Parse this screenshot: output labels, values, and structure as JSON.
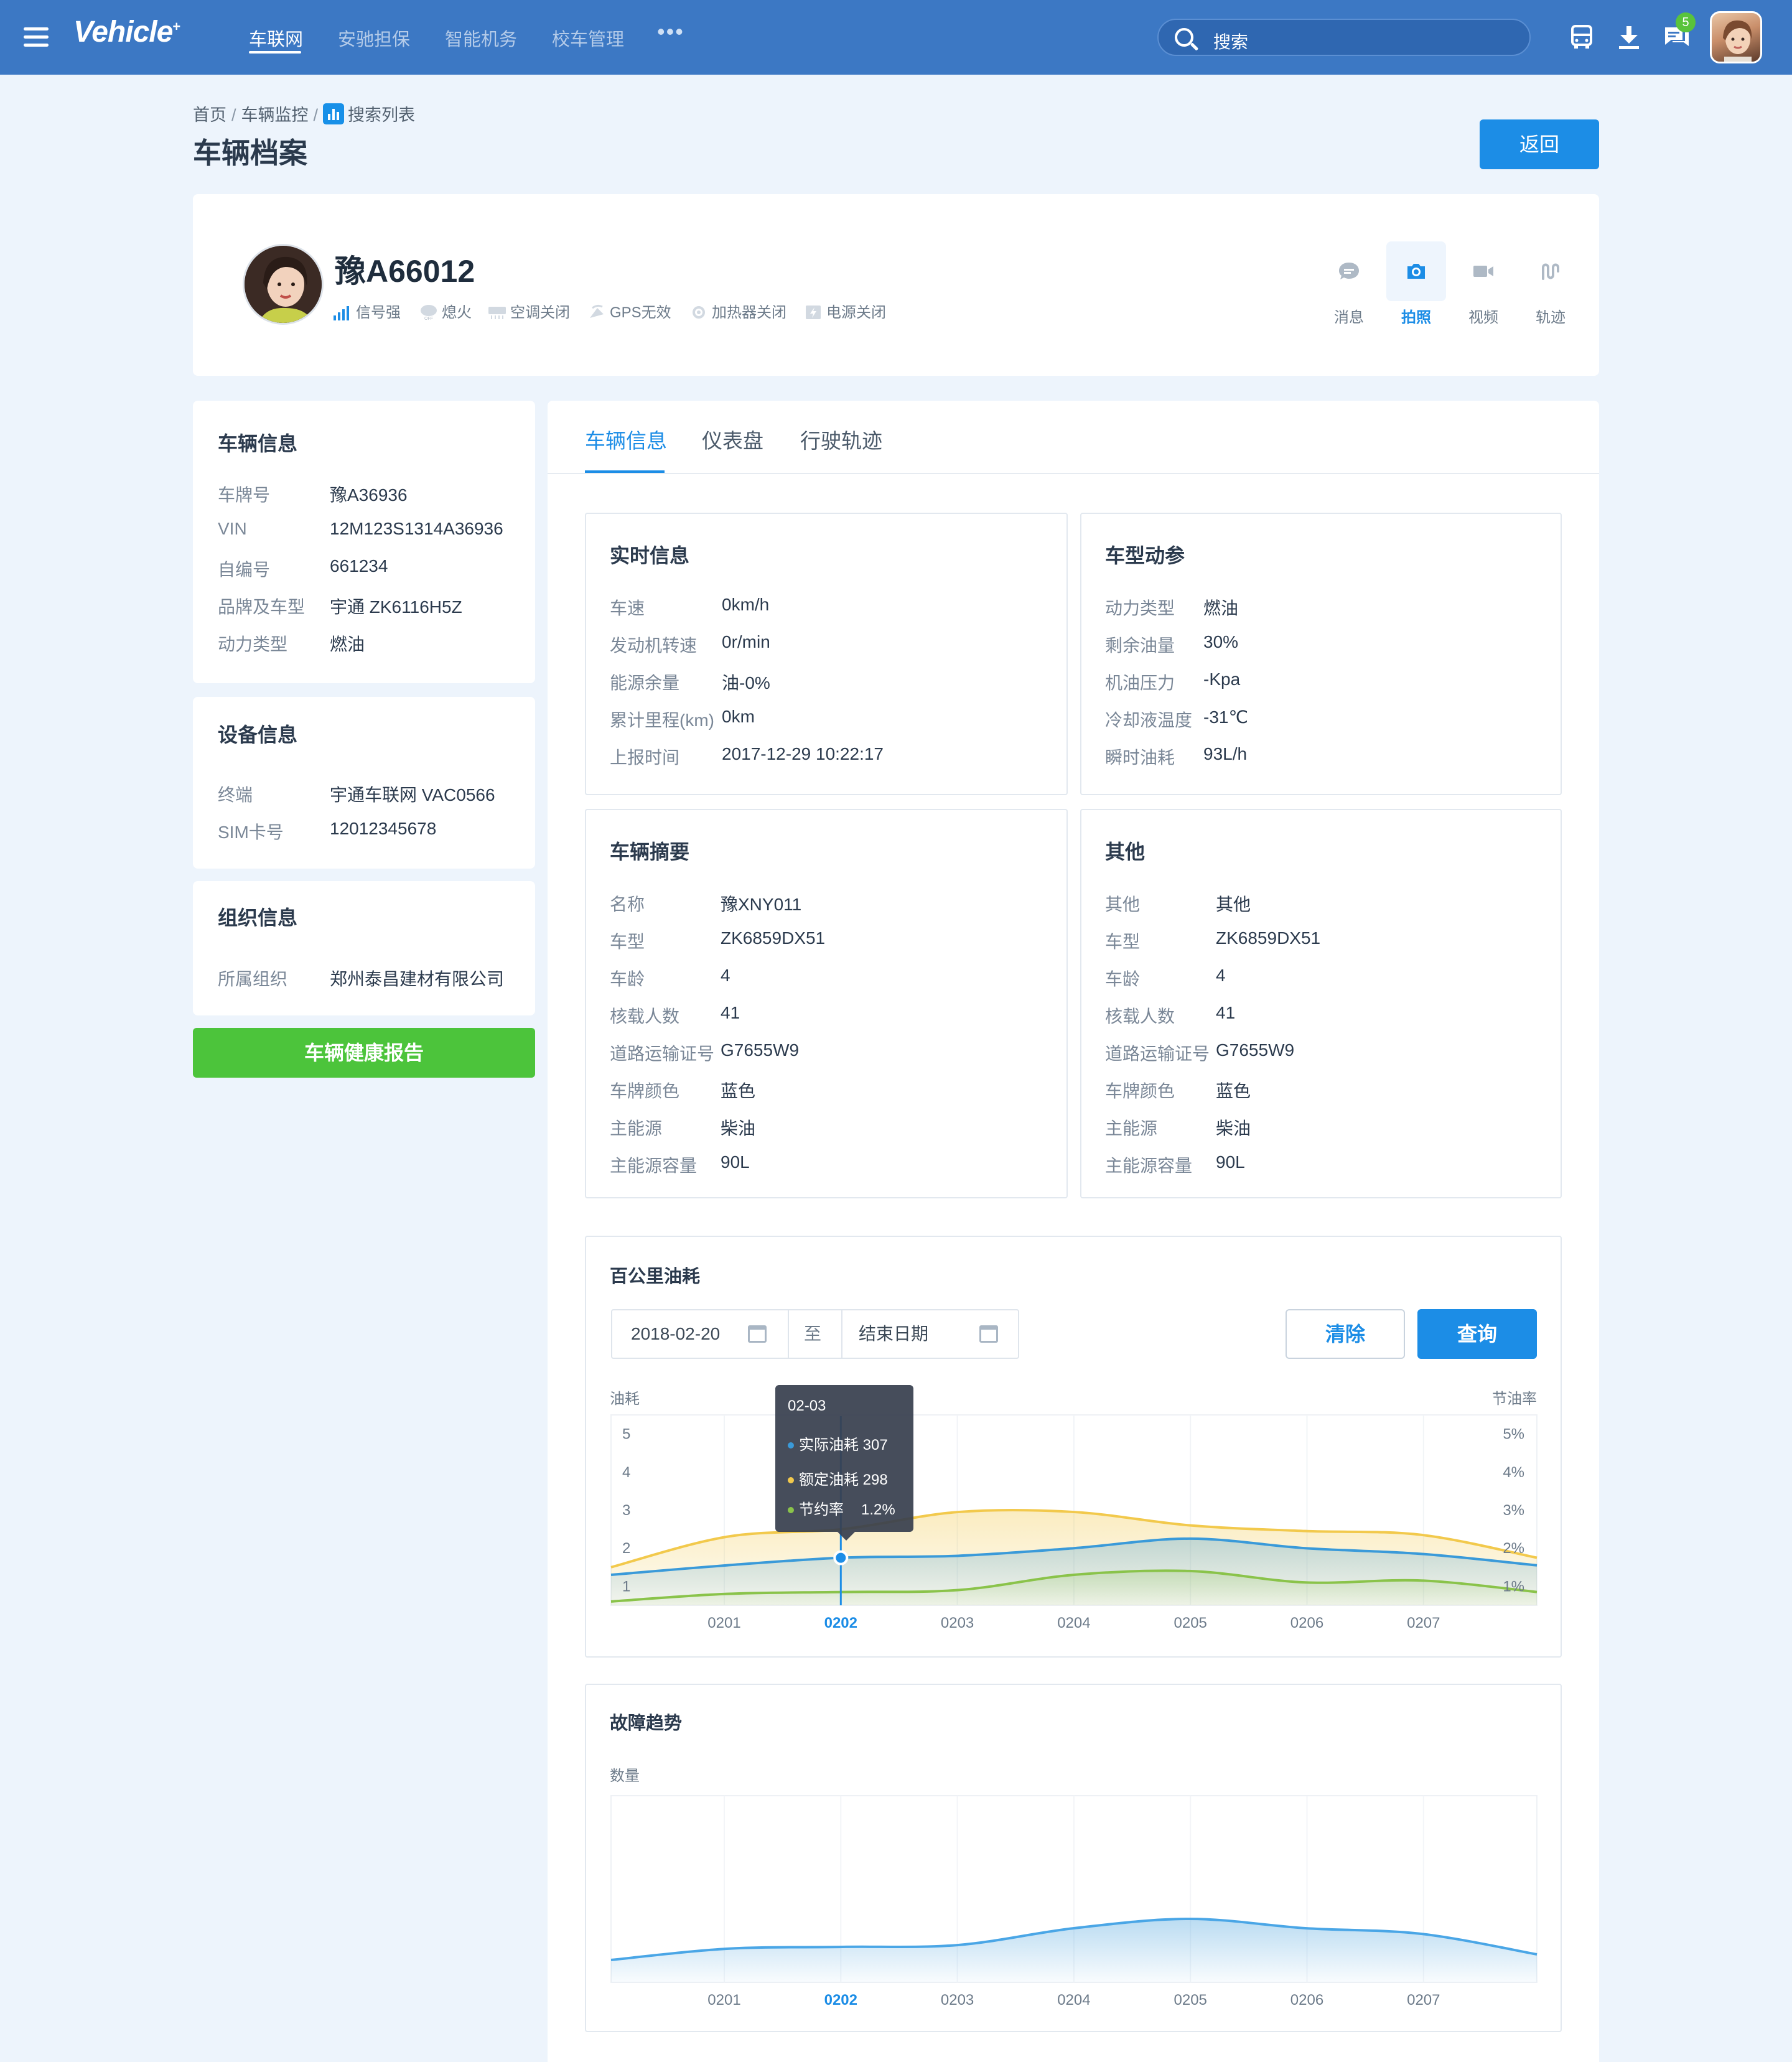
{
  "topbar": {
    "logo": "Vehicle",
    "logo_mark": "+",
    "nav": [
      "车联网",
      "安驰担保",
      "智能机务",
      "校车管理"
    ],
    "more": "•••",
    "search_label": "搜索",
    "message_count": "5"
  },
  "breadcrumb": [
    "首页",
    "车辆监控",
    "搜索列表"
  ],
  "page_title": "车辆档案",
  "back_label": "返回",
  "vehicle": {
    "plate": "豫A66012",
    "statuses": [
      "信号强",
      "熄火",
      "空调关闭",
      "GPS无效",
      "加热器关闭",
      "电源关闭"
    ],
    "actions": [
      "消息",
      "拍照",
      "视频",
      "轨迹"
    ]
  },
  "vehicle_info": {
    "title": "车辆信息",
    "rows": [
      {
        "k": "车牌号",
        "v": "豫A36936"
      },
      {
        "k": "VIN",
        "v": "12M123S1314A36936"
      },
      {
        "k": "自编号",
        "v": "661234"
      },
      {
        "k": "品牌及车型",
        "v": "宇通 ZK6116H5Z"
      },
      {
        "k": "动力类型",
        "v": "燃油"
      }
    ]
  },
  "device_info": {
    "title": "设备信息",
    "rows": [
      {
        "k": "终端",
        "v": "宇通车联网 VAC0566"
      },
      {
        "k": "SIM卡号",
        "v": "12012345678"
      }
    ]
  },
  "org_info": {
    "title": "组织信息",
    "rows": [
      {
        "k": "所属组织",
        "v": "郑州泰昌建材有限公司"
      }
    ]
  },
  "health_report_label": "车辆健康报告",
  "tabs": [
    "车辆信息",
    "仪表盘",
    "行驶轨迹"
  ],
  "realtime": {
    "title": "实时信息",
    "rows": [
      {
        "k": "车速",
        "v": "0km/h"
      },
      {
        "k": "发动机转速",
        "v": "0r/min"
      },
      {
        "k": "能源余量",
        "v": "油-0%"
      },
      {
        "k": "累计里程(km)",
        "v": "0km"
      },
      {
        "k": "上报时间",
        "v": "2017-12-29 10:22:17"
      }
    ]
  },
  "model_params": {
    "title": "车型动参",
    "rows": [
      {
        "k": "动力类型",
        "v": "燃油"
      },
      {
        "k": "剩余油量",
        "v": "30%"
      },
      {
        "k": "机油压力",
        "v": "-Kpa"
      },
      {
        "k": "冷却液温度",
        "v": "-31℃"
      },
      {
        "k": "瞬时油耗",
        "v": "93L/h"
      }
    ]
  },
  "summary": {
    "title": "车辆摘要",
    "rows": [
      {
        "k": "名称",
        "v": "豫XNY011"
      },
      {
        "k": "车型",
        "v": "ZK6859DX51"
      },
      {
        "k": "车龄",
        "v": "4"
      },
      {
        "k": "核载人数",
        "v": "41"
      },
      {
        "k": "道路运输证号",
        "v": "G7655W9"
      },
      {
        "k": "车牌颜色",
        "v": "蓝色"
      },
      {
        "k": "主能源",
        "v": "柴油"
      },
      {
        "k": "主能源容量",
        "v": "90L"
      }
    ]
  },
  "other": {
    "title": "其他",
    "rows": [
      {
        "k": "其他",
        "v": "其他"
      },
      {
        "k": "车型",
        "v": "ZK6859DX51"
      },
      {
        "k": "车龄",
        "v": "4"
      },
      {
        "k": "核载人数",
        "v": "41"
      },
      {
        "k": "道路运输证号",
        "v": "G7655W9"
      },
      {
        "k": "车牌颜色",
        "v": "蓝色"
      },
      {
        "k": "主能源",
        "v": "柴油"
      },
      {
        "k": "主能源容量",
        "v": "90L"
      }
    ]
  },
  "fuel_chart": {
    "title": "百公里油耗",
    "start_date": "2018-02-20",
    "to_label": "至",
    "end_placeholder": "结束日期",
    "clear_label": "清除",
    "query_label": "查询",
    "left_axis_label": "油耗",
    "right_axis_label": "节油率",
    "tooltip": {
      "date": "02-03",
      "rows": [
        {
          "name": "实际油耗",
          "value": "307"
        },
        {
          "name": "额定油耗",
          "value": "298"
        },
        {
          "name": "节约率",
          "value": "1.2%"
        }
      ]
    }
  },
  "fault_chart": {
    "title": "故障趋势",
    "axis_label": "数量"
  },
  "colors": {
    "brand": "#3c78c4",
    "accent": "#1c8de6",
    "success": "#4cc43b",
    "series_actual": "#3a9ad9",
    "series_rated": "#f2c94c",
    "series_saving": "#8ac34a"
  },
  "chart_data": [
    {
      "type": "area",
      "x": [
        "0201",
        "0202",
        "0203",
        "0204",
        "0205",
        "0206",
        "0207"
      ],
      "highlight_x": "0202",
      "left_ticks": [
        "1",
        "2",
        "3",
        "4",
        "5"
      ],
      "right_ticks": [
        "1%",
        "2%",
        "3%",
        "4%",
        "5%"
      ],
      "ylim": [
        0.5,
        5.5
      ],
      "series": [
        {
          "name": "实际油耗",
          "values": [
            1.3,
            1.55,
            1.75,
            1.8,
            2.0,
            2.25,
            2.0,
            1.85,
            1.55
          ]
        },
        {
          "name": "额定油耗",
          "values": [
            1.5,
            2.3,
            2.5,
            2.95,
            2.95,
            2.6,
            2.45,
            2.35,
            1.75
          ]
        },
        {
          "name": "节约率",
          "values": [
            0.6,
            0.8,
            0.85,
            0.9,
            1.3,
            1.4,
            1.1,
            1.15,
            0.85
          ]
        }
      ]
    },
    {
      "type": "area",
      "x": [
        "0201",
        "0202",
        "0203",
        "0204",
        "0205",
        "0206",
        "0207"
      ],
      "highlight_x": "0202",
      "series": [
        {
          "values": [
            1.2,
            1.8,
            1.9,
            2.0,
            2.9,
            3.4,
            2.9,
            2.6,
            1.5
          ]
        }
      ]
    }
  ]
}
